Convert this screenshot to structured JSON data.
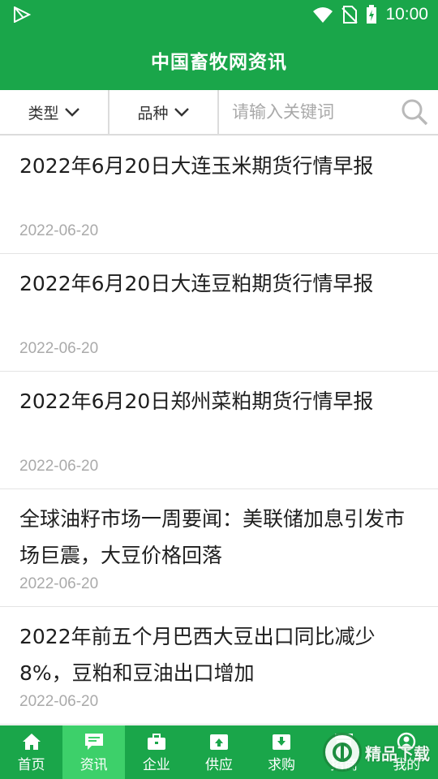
{
  "status_bar": {
    "time": "10:00"
  },
  "app": {
    "title": "中国畜牧网资讯"
  },
  "filters": {
    "type_label": "类型",
    "variety_label": "品种"
  },
  "search": {
    "placeholder": "请输入关键词"
  },
  "articles": [
    {
      "title": "2022年6月20日大连玉米期货行情早报",
      "date": "2022-06-20"
    },
    {
      "title": "2022年6月20日大连豆粕期货行情早报",
      "date": "2022-06-20"
    },
    {
      "title": "2022年6月20日郑州菜粕期货行情早报",
      "date": "2022-06-20"
    },
    {
      "title": "全球油籽市场一周要闻：美联储加息引发市场巨震，大豆价格回落",
      "date": "2022-06-20"
    },
    {
      "title": "2022年前五个月巴西大豆出口同比减少8%，豆粕和豆油出口增加",
      "date": "2022-06-20"
    }
  ],
  "tabs": [
    {
      "label": "首页",
      "icon": "home-icon"
    },
    {
      "label": "资讯",
      "icon": "news-icon",
      "active": true
    },
    {
      "label": "企业",
      "icon": "briefcase-icon"
    },
    {
      "label": "供应",
      "icon": "supply-icon"
    },
    {
      "label": "求购",
      "icon": "purchase-icon"
    },
    {
      "label": "招商",
      "icon": "store-icon"
    },
    {
      "label": "我的",
      "icon": "user-icon"
    }
  ],
  "watermark": {
    "text": "精品下载"
  },
  "colors": {
    "primary": "#1aa64a",
    "active_tab": "#3dd06a",
    "date_gray": "#aaaaaa"
  }
}
